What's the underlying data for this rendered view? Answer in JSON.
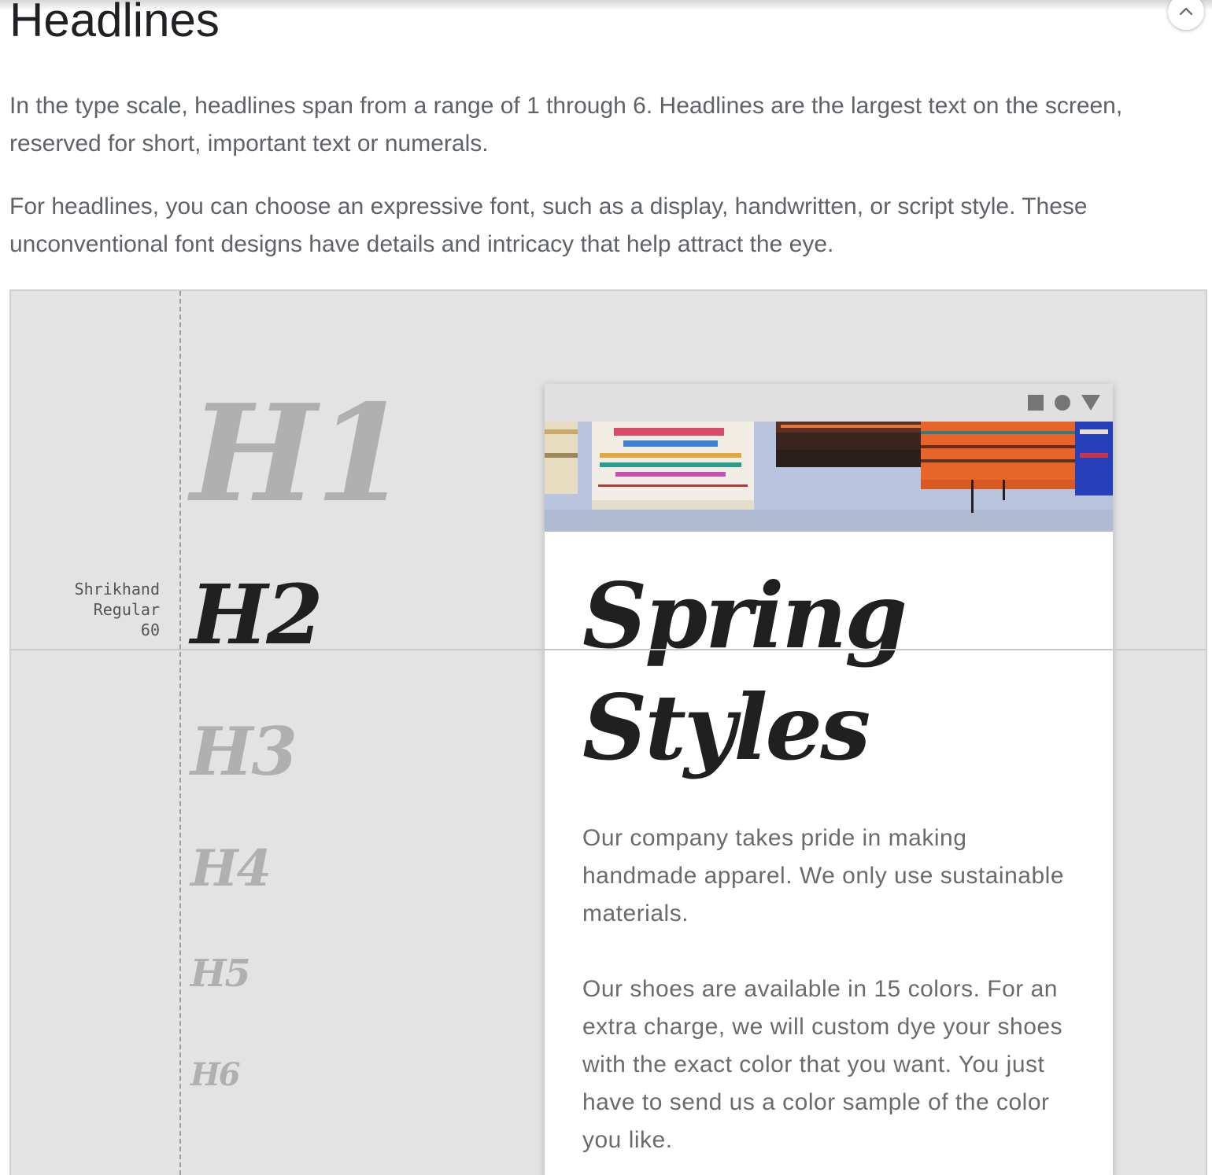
{
  "section": {
    "title": "Headlines",
    "paragraphs": [
      "In the type scale, headlines span from a range of 1 through 6. Headlines are the largest text on the screen, reserved for short, important text or numerals.",
      "For headlines, you can choose an expressive font, such as a display, handwritten, or script style. These unconventional font designs have details and intricacy that help attract the eye."
    ]
  },
  "collapse_icon": "chevron-up-icon",
  "type_scale": {
    "spec": {
      "font_name": "Shrikhand",
      "font_style": "Regular",
      "size": "60"
    },
    "levels": [
      "H1",
      "H2",
      "H3",
      "H4",
      "H5",
      "H6"
    ],
    "highlighted_level": "H2"
  },
  "device": {
    "status_icons": [
      "square-icon",
      "circle-icon",
      "triangle-icon"
    ],
    "hero_image": "colorful woven rugs hanging on a wall",
    "title": "Spring Styles",
    "body": [
      "Our company takes pride in making handmade apparel. We only use sustainable materials.",
      "Our shoes are available in 15 colors. For an extra charge, we will custom dye your shoes with the exact color that you want. You just have to send us a color sample of the color you like."
    ]
  },
  "colors": {
    "demo_background": "#e3e3e3",
    "highlight_text": "#202020",
    "muted_text": "#b0b0b0",
    "body_text": "#6b6b6b"
  }
}
